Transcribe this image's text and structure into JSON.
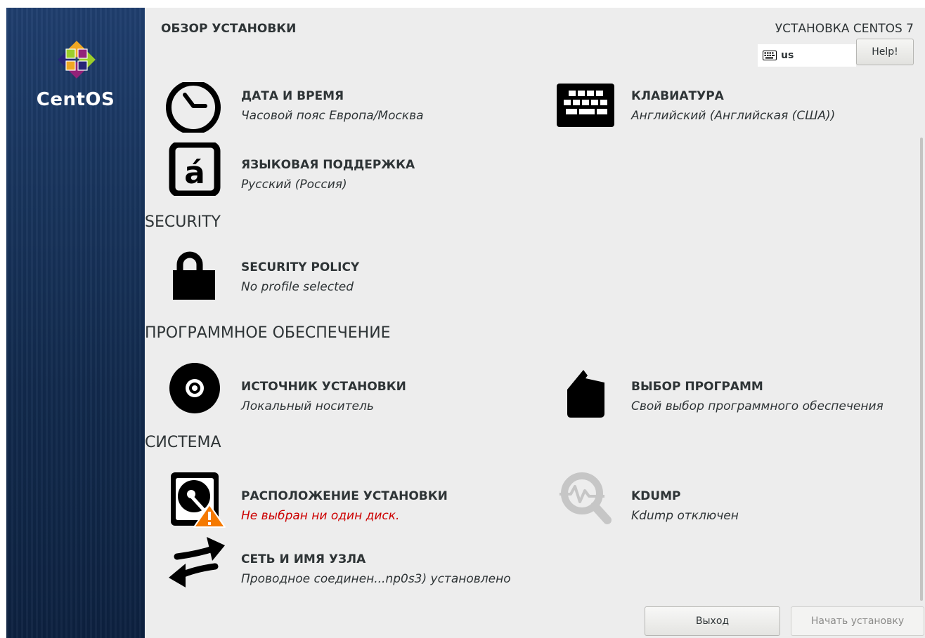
{
  "sidebar": {
    "brand": "CentOS",
    "logo_icon": "centos-logo-icon"
  },
  "header": {
    "page_title": "ОБЗОР УСТАНОВКИ",
    "product_title": "УСТАНОВКА CENTOS 7",
    "keyboard_layout": "us",
    "help_label": "Help!"
  },
  "localization": {
    "datetime": {
      "title": "ДАТА И ВРЕМЯ",
      "status": "Часовой пояс Европа/Москва",
      "icon": "clock-icon"
    },
    "keyboard": {
      "title": "КЛАВИАТУРА",
      "status": "Английский (Английская (США))",
      "icon": "keyboard-icon"
    },
    "language": {
      "title": "ЯЗЫКОВАЯ ПОДДЕРЖКА",
      "status": "Русский (Россия)",
      "icon": "language-icon"
    }
  },
  "security": {
    "header": "SECURITY",
    "policy": {
      "title": "SECURITY POLICY",
      "status": "No profile selected",
      "icon": "lock-icon"
    }
  },
  "software": {
    "header": "ПРОГРАММНОЕ ОБЕСПЕЧЕНИЕ",
    "source": {
      "title": "ИСТОЧНИК УСТАНОВКИ",
      "status": "Локальный носитель",
      "icon": "disc-icon"
    },
    "selection": {
      "title": "ВЫБОР ПРОГРАММ",
      "status": "Свой выбор программного обеспечения",
      "icon": "package-icon"
    }
  },
  "system": {
    "header": "СИСТЕМА",
    "destination": {
      "title": "РАСПОЛОЖЕНИЕ УСТАНОВКИ",
      "status": "Не выбран ни один диск.",
      "icon": "harddisk-warning-icon"
    },
    "kdump": {
      "title": "KDUMP",
      "status": "Kdump отключен",
      "icon": "kdump-magnifier-icon"
    },
    "network": {
      "title": "СЕТЬ И ИМЯ УЗЛА",
      "status": "Проводное соединен...np0s3) установлено",
      "icon": "network-arrows-icon"
    }
  },
  "footer": {
    "quit_label": "Выход",
    "begin_label": "Начать установку"
  },
  "colors": {
    "sidebar": "#1a375f",
    "error": "#cc0000",
    "background": "#ededed"
  }
}
